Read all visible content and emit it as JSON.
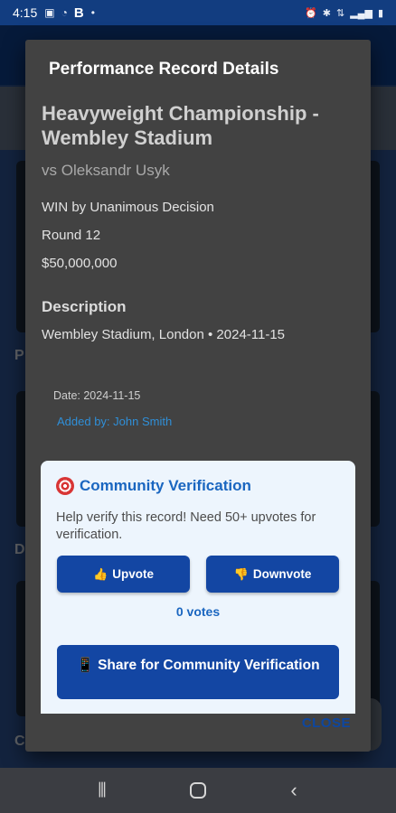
{
  "status_bar": {
    "time": "4:15",
    "left_icons": [
      "image-icon",
      "cast-icon"
    ],
    "b_label": "B",
    "dot": "•",
    "right_icons": [
      "alarm-icon",
      "bluetooth-icon",
      "lte-icon",
      "signal-icon",
      "battery-icon"
    ]
  },
  "dialog": {
    "title": "Performance Record Details",
    "record_title": "Heavyweight Championship - Wembley Stadium",
    "opponent": "vs Oleksandr Usyk",
    "result": "WIN by Unanimous Decision",
    "round": "Round 12",
    "purse": "$50,000,000",
    "description_heading": "Description",
    "description": "Wembley Stadium, London • 2024-11-15",
    "date_meta": "Date: 2024-11-15",
    "added_by": "Added by: John Smith",
    "verification": {
      "title": "Community Verification",
      "text": "Help verify this record! Need 50+ upvotes for verification.",
      "upvote_label": "Upvote",
      "downvote_label": "Downvote",
      "vote_count": "0 votes",
      "share_label": "Share for Community Verification"
    },
    "close_label": "CLOSE"
  },
  "background": {
    "partial_labels": [
      "P",
      "D",
      "C"
    ]
  },
  "colors": {
    "accent": "#1a66c0",
    "button": "#1346a3",
    "dialog_bg": "#424242"
  }
}
